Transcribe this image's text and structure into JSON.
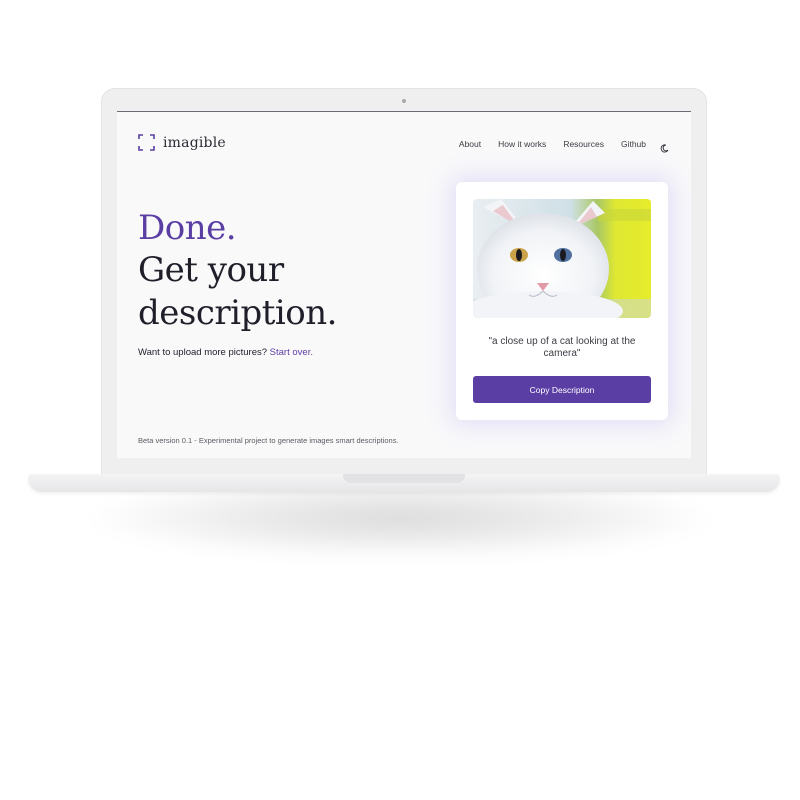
{
  "brand": {
    "name": "imagible",
    "accent": "#5b3ea4"
  },
  "nav": {
    "items": [
      "About",
      "How it works",
      "Resources",
      "Github"
    ],
    "theme_icon": "moon-icon"
  },
  "hero": {
    "done": "Done.",
    "line2": "Get your",
    "line3": "description.",
    "upload_prompt": "Want to upload more pictures?",
    "start_over": "Start over."
  },
  "result": {
    "image": "white-cat-photo",
    "caption": "\"a close up of a cat looking at the camera\"",
    "copy_button": "Copy Description"
  },
  "footer": {
    "note": "Beta version 0.1 - Experimental project to generate images smart descriptions."
  }
}
